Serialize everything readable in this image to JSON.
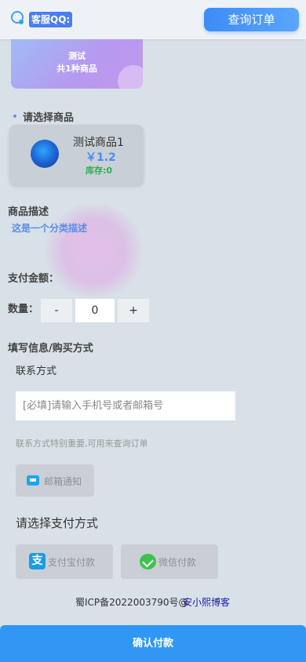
{
  "header": {
    "kefu_label": "客服QQ:",
    "query_label": "查询订单"
  },
  "category": {
    "name": "测试",
    "count_text": "共1种商品"
  },
  "select_product_title": "请选择商品",
  "product": {
    "name": "测试商品1",
    "price": "￥1.2",
    "stock": "库存:0"
  },
  "description": {
    "title": "商品描述",
    "text": "这是一个分类描述"
  },
  "payment_amount_label": "支付金额：",
  "quantity": {
    "label": "数量：",
    "minus": "-",
    "value": "0",
    "plus": "+"
  },
  "fill_info_title": "填写信息/购买方式",
  "contact": {
    "label": "联系方式",
    "placeholder": "[必填]请输入手机号或者邮箱号",
    "hint": "联系方式特别重要,可用来查询订单",
    "notify_label": "邮箱通知"
  },
  "payment": {
    "title": "请选择支付方式",
    "alipay_label": "支付宝付款",
    "wechat_label": "微信付款"
  },
  "footer": {
    "icp": "蜀ICP备2022003790号@",
    "site_link": "安小熙博客"
  },
  "confirm_label": "确认付款",
  "colors": {
    "primary": "#3197f5",
    "price": "#4a8df5",
    "stock": "#2eae59",
    "background": "#d8e0e8"
  },
  "icons": [
    "headset-icon",
    "alipay-icon",
    "wechat-icon",
    "mail-icon",
    "check-icon"
  ]
}
